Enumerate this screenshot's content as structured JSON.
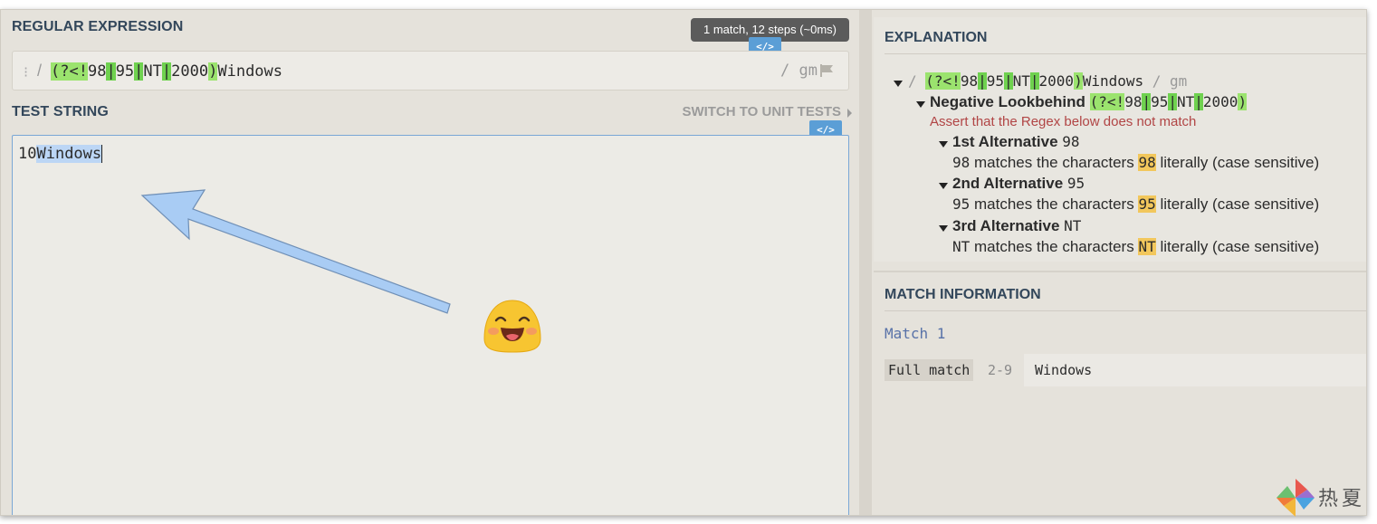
{
  "regex_section": {
    "title": "REGULAR EXPRESSION",
    "status": "1 match, 12 steps (~0ms)",
    "code_tag": "</>",
    "delimiter_open": "/",
    "pattern_parts": {
      "p1": "(?<!",
      "p2": "98",
      "p3": "|",
      "p4": "95",
      "p5": "|",
      "p6": "NT",
      "p7": "|",
      "p8": "2000",
      "p9": ")",
      "p10": "Windows"
    },
    "flags": "/ gm",
    "handle_icon": "drag-handle-icon",
    "flag_icon": "flag-icon"
  },
  "test_section": {
    "title": "TEST STRING",
    "unit_tests_link": "SWITCH TO UNIT TESTS",
    "code_tag": "</>",
    "text_before": "10",
    "text_match": "Windows"
  },
  "explanation": {
    "title": "EXPLANATION",
    "root_delim_open": "/",
    "root_flags": "/ gm",
    "lookbehind_label": "Negative Lookbehind",
    "lookbehind_pattern": "(?<!98|95|NT|2000)",
    "assert_note": "Assert that the Regex below does not match",
    "alternatives": [
      {
        "label": "1st Alternative",
        "token": "98",
        "desc_token": "98",
        "desc_mid": "matches the characters",
        "desc_hl": "98",
        "desc_tail": "literally (case sensitive)"
      },
      {
        "label": "2nd Alternative",
        "token": "95",
        "desc_token": "95",
        "desc_mid": "matches the characters",
        "desc_hl": "95",
        "desc_tail": "literally (case sensitive)"
      },
      {
        "label": "3rd Alternative",
        "token": "NT",
        "desc_token": "NT",
        "desc_mid": "matches the characters",
        "desc_hl": "NT",
        "desc_tail": "literally (case sensitive)"
      }
    ]
  },
  "match_info": {
    "title": "MATCH INFORMATION",
    "match_label": "Match 1",
    "full_match_label": "Full match",
    "full_match_range": "2-9",
    "full_match_value": "Windows"
  },
  "watermark": {
    "text": "热夏",
    "icon": "pinwheel-logo-icon"
  },
  "colors": {
    "group_green": "#9be36e",
    "alt_green": "#6fd14f",
    "match_blue": "#bcd6f5",
    "literal_highlight": "#f2c75c",
    "section_title": "#33475b",
    "arrow": "#a9ccf4"
  }
}
